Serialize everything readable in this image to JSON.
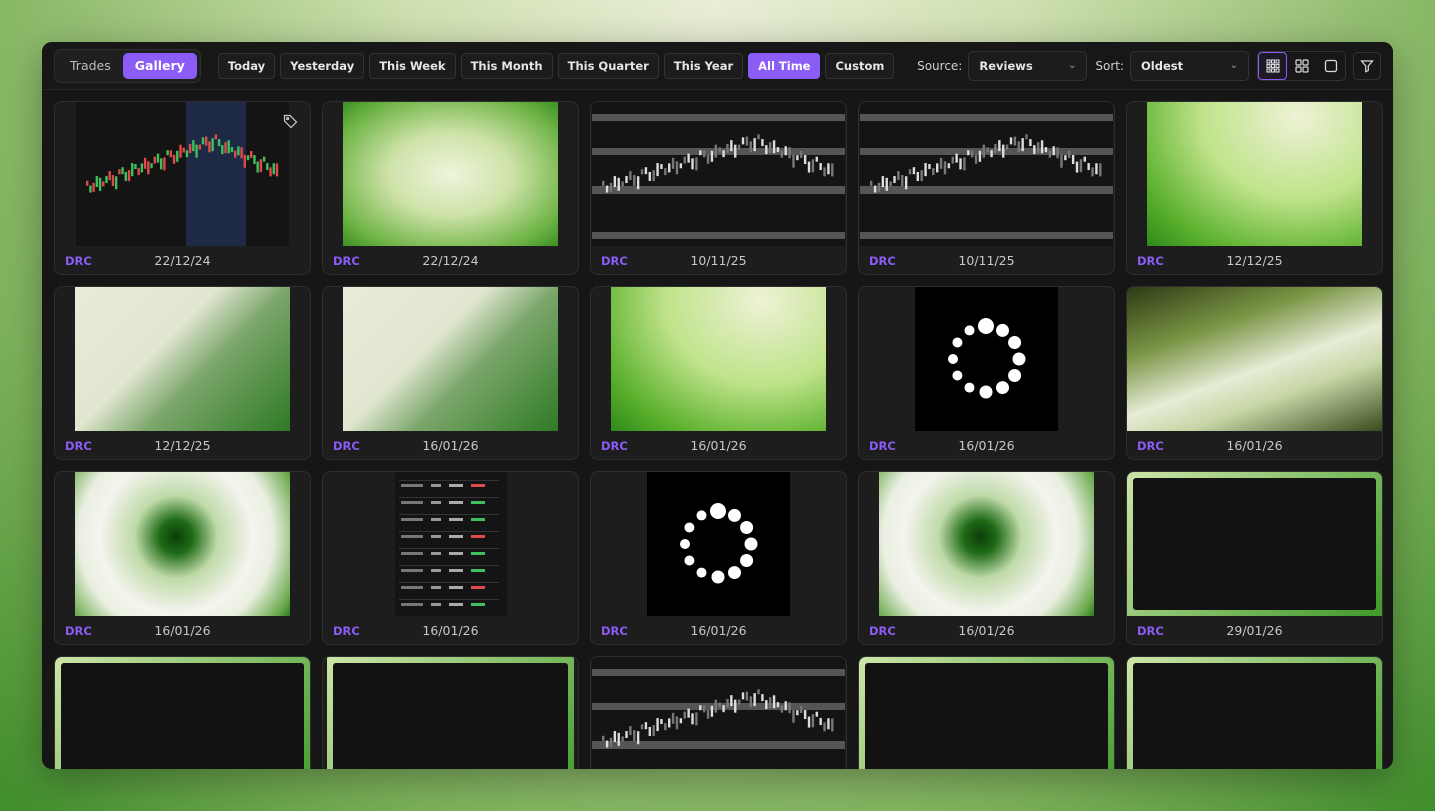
{
  "tabs": [
    {
      "label": "Trades",
      "active": false
    },
    {
      "label": "Gallery",
      "active": true
    }
  ],
  "ranges": [
    {
      "label": "Today",
      "active": false
    },
    {
      "label": "Yesterday",
      "active": false
    },
    {
      "label": "This Week",
      "active": false
    },
    {
      "label": "This Month",
      "active": false
    },
    {
      "label": "This Quarter",
      "active": false
    },
    {
      "label": "This Year",
      "active": false
    },
    {
      "label": "All Time",
      "active": true
    },
    {
      "label": "Custom",
      "active": false
    }
  ],
  "source": {
    "label": "Source:",
    "value": "Reviews"
  },
  "sort": {
    "label": "Sort:",
    "value": "Oldest"
  },
  "accent": "#8b5cf6",
  "cards": [
    {
      "source": "DRC",
      "date": "22/12/24",
      "thumb": "chart-light",
      "tag": true
    },
    {
      "source": "DRC",
      "date": "22/12/24",
      "thumb": "soft"
    },
    {
      "source": "DRC",
      "date": "10/11/25",
      "thumb": "chart-gray"
    },
    {
      "source": "DRC",
      "date": "10/11/25",
      "thumb": "chart-gray"
    },
    {
      "source": "DRC",
      "date": "12/12/25",
      "thumb": "fig"
    },
    {
      "source": "DRC",
      "date": "12/12/25",
      "thumb": "blob"
    },
    {
      "source": "DRC",
      "date": "16/01/26",
      "thumb": "blob"
    },
    {
      "source": "DRC",
      "date": "16/01/26",
      "thumb": "fig"
    },
    {
      "source": "DRC",
      "date": "16/01/26",
      "thumb": "loader"
    },
    {
      "source": "DRC",
      "date": "16/01/26",
      "thumb": "streak"
    },
    {
      "source": "DRC",
      "date": "16/01/26",
      "thumb": "hole"
    },
    {
      "source": "DRC",
      "date": "16/01/26",
      "thumb": "table"
    },
    {
      "source": "DRC",
      "date": "16/01/26",
      "thumb": "loader"
    },
    {
      "source": "DRC",
      "date": "16/01/26",
      "thumb": "hole"
    },
    {
      "source": "DRC",
      "date": "29/01/26",
      "thumb": "dash"
    },
    {
      "source": "",
      "date": "",
      "thumb": "dash"
    },
    {
      "source": "",
      "date": "",
      "thumb": "settings"
    },
    {
      "source": "",
      "date": "",
      "thumb": "chart-gray"
    },
    {
      "source": "",
      "date": "",
      "thumb": "dash-bars"
    },
    {
      "source": "",
      "date": "",
      "thumb": "dash-bars"
    }
  ]
}
